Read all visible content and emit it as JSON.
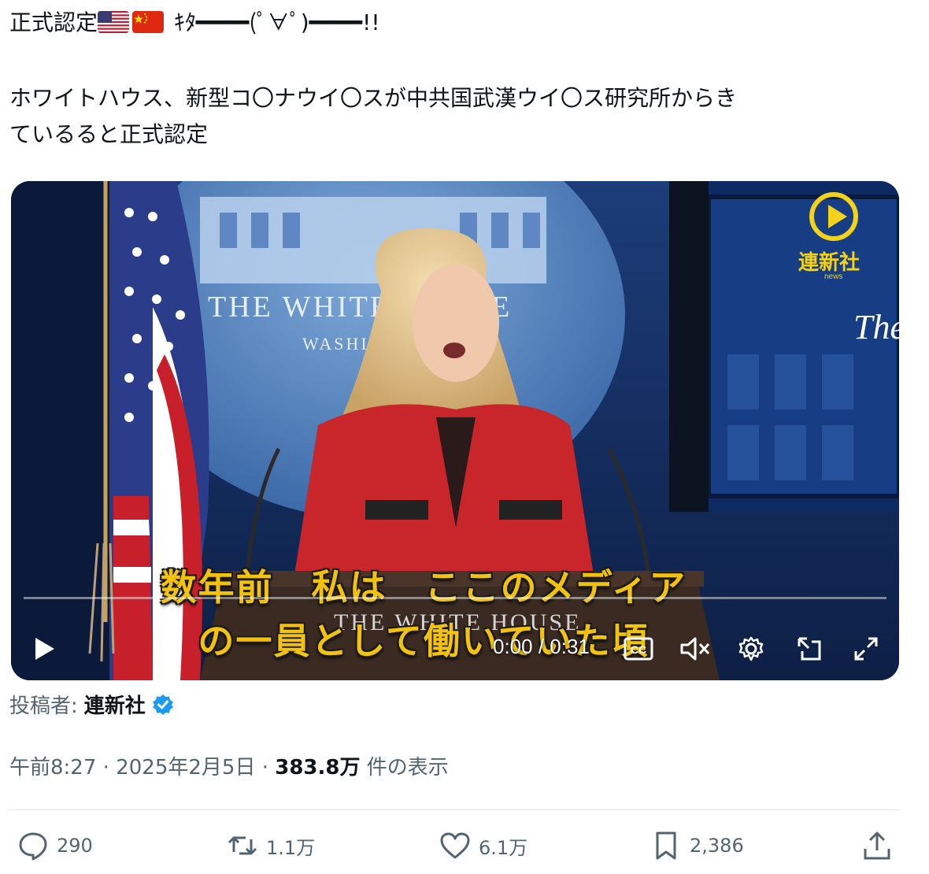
{
  "post": {
    "line1_prefix": "正式認定",
    "line1_suffix": " ｷﾀ━━━━(ﾟ∀ﾟ)━━━━!!",
    "line2": "ホワイトハウス、新型コ〇ナウイ〇スが中共国武漢ウイ〇ス研究所からき",
    "line3": "ているると正式認定"
  },
  "video": {
    "subtitle_line1": "数年前　私は　ここのメディア",
    "subtitle_line2": "の一員として働いていた頃",
    "time": "0:00 / 0:31",
    "progress": 0,
    "watermark_text": "連新社",
    "watermark_sub": "news",
    "backdrop_text": "THE WHITE HOUSE",
    "backdrop_sub": "WASHINGTON",
    "side_text": "The",
    "podium_text": "THE WHITE HOUSE"
  },
  "byline": {
    "label": "投稿者:",
    "author": "連新社"
  },
  "meta": {
    "time": "午前8:27",
    "sep": " · ",
    "date": "2025年2月5日",
    "views_count": "383.8万",
    "views_label": " 件の表示"
  },
  "actions": {
    "replies": "290",
    "reposts": "1.1万",
    "likes": "6.1万",
    "bookmarks": "2,386"
  },
  "colors": {
    "verified": "#1d9bf0",
    "subtitle": "#f2c20f",
    "muted": "#536471"
  },
  "icons": [
    "us-flag-icon",
    "china-flag-icon",
    "play-icon",
    "captions-icon",
    "mute-icon",
    "settings-icon",
    "pip-icon",
    "fullscreen-icon",
    "verified-icon",
    "reply-icon",
    "repost-icon",
    "like-icon",
    "bookmark-icon",
    "share-icon"
  ]
}
